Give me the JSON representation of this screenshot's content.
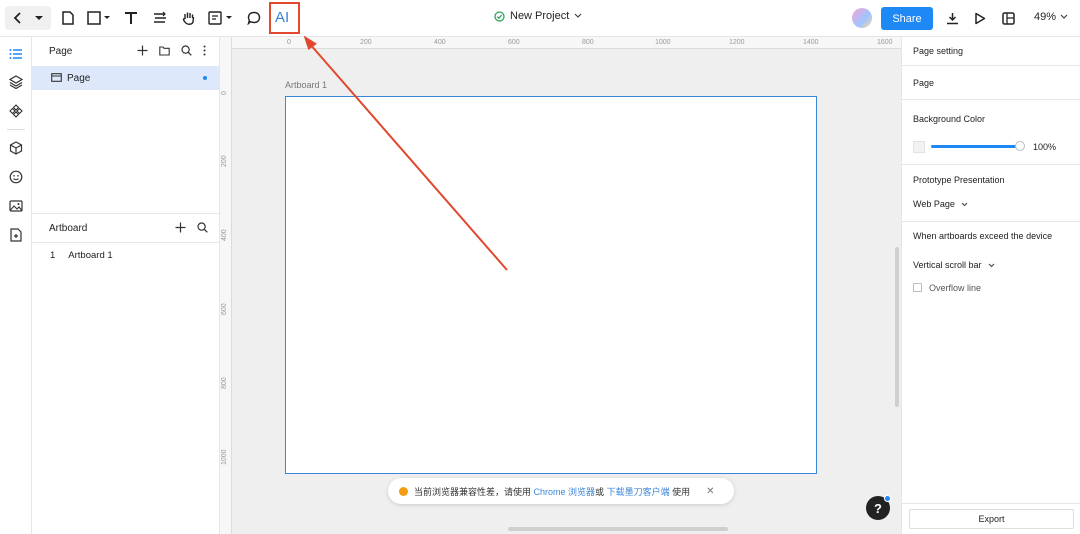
{
  "toolbar": {
    "ai_label": "AI",
    "project_name": "New Project",
    "share_label": "Share",
    "zoom": "49%"
  },
  "pages_panel": {
    "title": "Page",
    "pages": [
      {
        "label": "Page",
        "selected": true
      }
    ],
    "artboards_title": "Artboard",
    "artboards": [
      {
        "index": "1",
        "label": "Artboard 1"
      }
    ]
  },
  "canvas": {
    "ruler_top": [
      "0",
      "200",
      "400",
      "600",
      "800",
      "1000",
      "1200",
      "1400",
      "1600"
    ],
    "ruler_left": [
      "0",
      "200",
      "400",
      "600",
      "800",
      "1000"
    ],
    "artboard_name": "Artboard 1",
    "notice": {
      "text1": "当前浏览器兼容性差，请使用",
      "link1": "Chrome 浏览器",
      "text2": "或",
      "link2": "下载墨刀客户端",
      "text3": "使用"
    },
    "help_label": "?"
  },
  "right_panel": {
    "title": "Page setting",
    "page_label": "Page",
    "bg_color_label": "Background Color",
    "bg_opacity": "100%",
    "prototype_label": "Prototype Presentation",
    "presentation_value": "Web Page",
    "exceed_label": "When artboards exceed the device",
    "scroll_value": "Vertical scroll bar",
    "overflow_label": "Overflow line",
    "export_label": "Export"
  },
  "colors": {
    "accent": "#1e88f5",
    "highlight": "#e0492d",
    "artboard_border": "#3b86d8"
  }
}
